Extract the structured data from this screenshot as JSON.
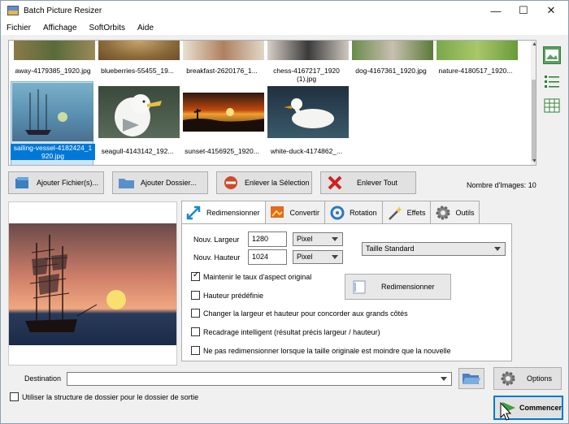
{
  "window": {
    "title": "Batch Picture Resizer",
    "minimize": "—",
    "maximize": "☐",
    "close": "✕"
  },
  "menu": [
    "Fichier",
    "Affichage",
    "SoftOrbits",
    "Aide"
  ],
  "gallery": {
    "row1": [
      "away-4179385_1920.jpg",
      "blueberries-55455_19...",
      "breakfast-2620176_1...",
      "chess-4167217_1920\n(1).jpg",
      "dog-4167361_1920.jpg",
      "nature-4180517_1920..."
    ],
    "row2": [
      "sailing-vessel-4182424_1\n920.jpg",
      "seagull-4143142_192...",
      "sunset-4156925_1920...",
      "white-duck-4174862_..."
    ],
    "selected_index": 0
  },
  "side_icons": [
    "image-view-icon",
    "list-view-icon",
    "grid-view-icon"
  ],
  "actions": {
    "add_files": "Ajouter Fichier(s)...",
    "add_folder": "Ajouter Dossier...",
    "remove_selection": "Enlever la Sélection",
    "remove_all": "Enlever Tout",
    "image_count": "Nombre d'Images: 10"
  },
  "tabs": [
    "Redimensionner",
    "Convertir",
    "Rotation",
    "Effets",
    "Outils"
  ],
  "resize": {
    "width_label": "Nouv. Largeur",
    "width_value": "1280",
    "height_label": "Nouv. Hauteur",
    "height_value": "1024",
    "unit_width": "Pixel",
    "unit_height": "Pixel",
    "size_preset": "Taille Standard",
    "keep_ratio": "Maintenir le taux d'aspect original",
    "keep_ratio_checked": true,
    "preset_height": "Hauteur prédéfinie",
    "match_sides": "Changer la largeur et hauteur pour concorder aux grands côtés",
    "smart_crop": "Recadrage intelligent (résultat précis largeur / hauteur)",
    "no_upscale": "Ne pas redimensionner lorsque la taille originale est moindre que la nouvelle",
    "resize_button": "Redimensionner"
  },
  "bottom": {
    "destination_label": "Destination",
    "destination_value": "",
    "folder_structure": "Utiliser la structure de dossier pour le dossier de sortie",
    "options": "Options",
    "start": "Commencer"
  }
}
